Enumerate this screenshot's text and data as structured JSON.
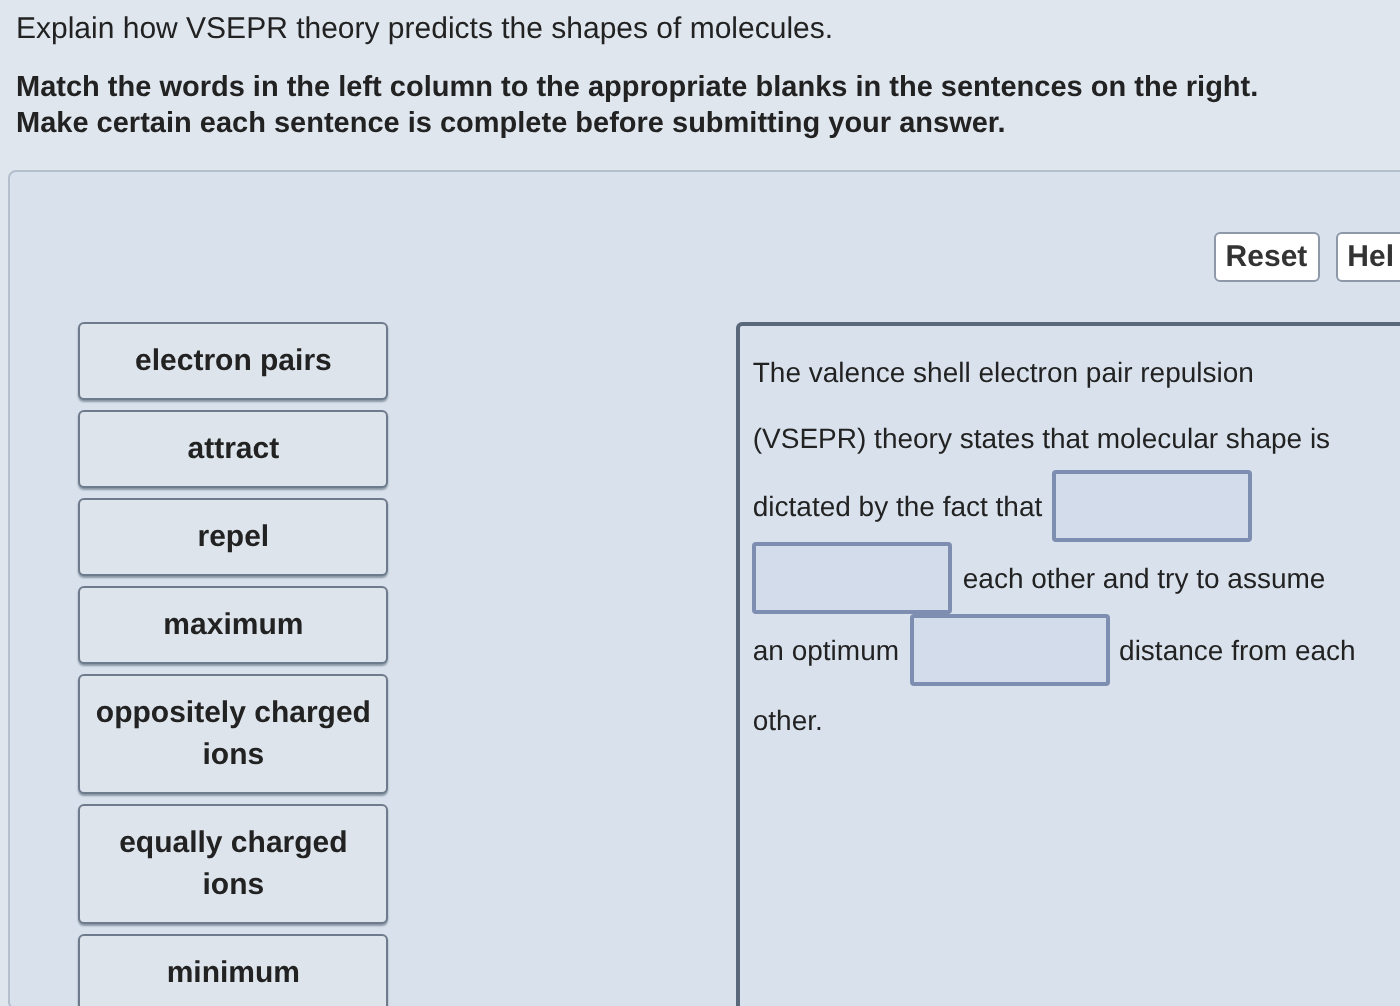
{
  "question": "Explain how VSEPR theory predicts the shapes of molecules.",
  "instructions": [
    "Match the words in the left column to the appropriate blanks in the sentences on the right.",
    "Make certain each sentence is complete before submitting your answer."
  ],
  "buttons": [
    "Reset",
    "Hel"
  ],
  "word_bank": [
    "electron pairs",
    "attract",
    "repel",
    "maximum",
    "oppositely charged ions",
    "equally charged ions",
    "minimum"
  ],
  "sentence": {
    "lines": [
      [
        {
          "kind": "text",
          "text": "The valence shell electron pair repulsion"
        }
      ],
      [
        {
          "kind": "text",
          "text": "(VSEPR) theory states that molecular shape is"
        }
      ],
      [
        {
          "kind": "text",
          "text": "dictated by the fact that"
        },
        {
          "kind": "blank"
        }
      ],
      [
        {
          "kind": "blank"
        },
        {
          "kind": "text",
          "text": "each other and try to assume"
        }
      ],
      [
        {
          "kind": "text",
          "text": "an optimum"
        },
        {
          "kind": "blank"
        },
        {
          "kind": "text",
          "text": "distance from each"
        }
      ],
      [
        {
          "kind": "text",
          "text": "other."
        }
      ]
    ]
  }
}
